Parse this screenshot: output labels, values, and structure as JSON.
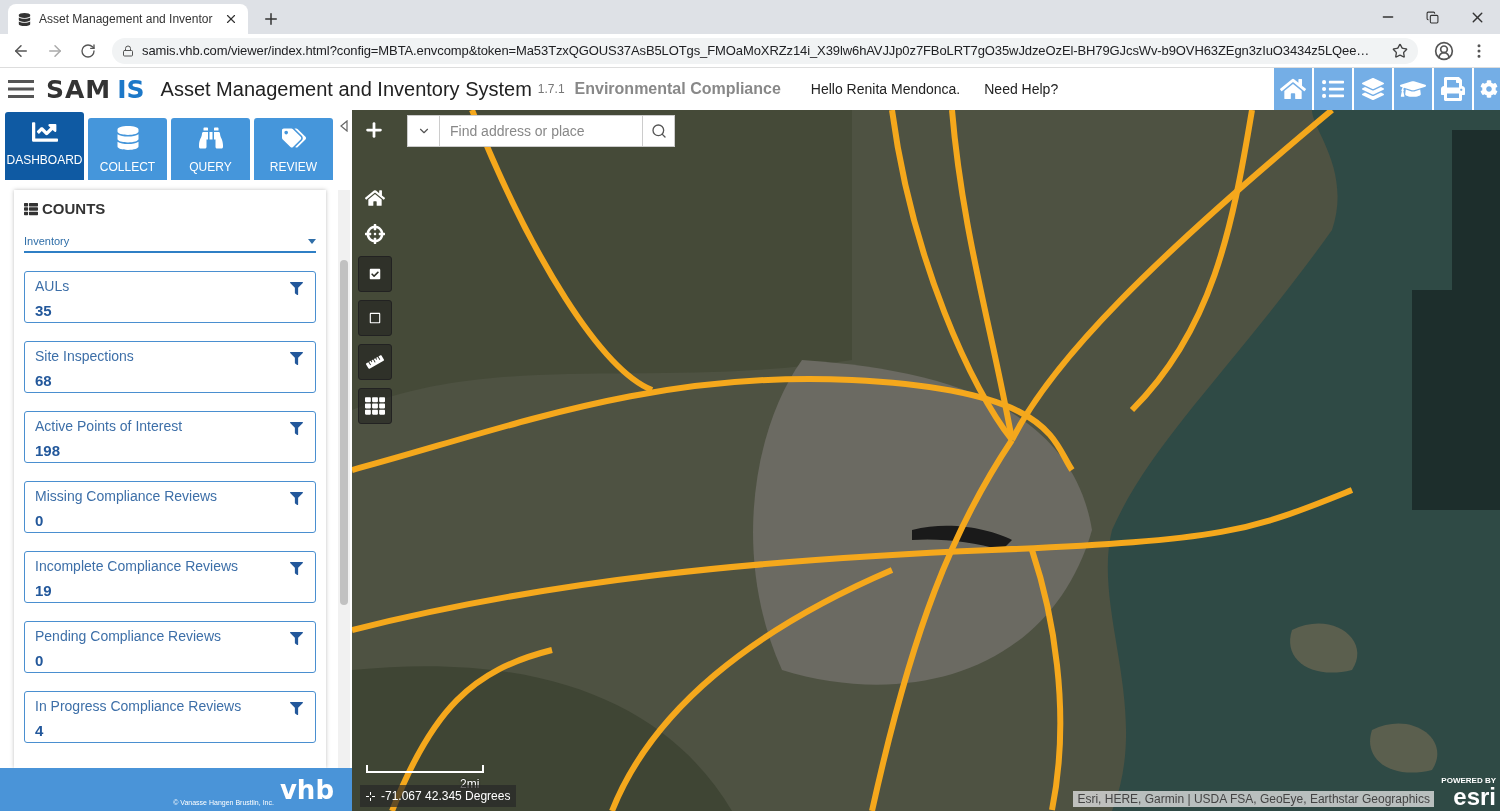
{
  "browser": {
    "tab_title": "Asset Management and Inventor",
    "address": "samis.vhb.com/viewer/index.html?config=MBTA.envcomp&token=Ma53TzxQGOUS37AsB5LOTgs_FMOaMoXRZz14i_X39lw6hAVJJp0z7FBoLRT7gO35wJdzeOzEl-BH79GJcsWv-b9OVH63ZEgn3zIuO3434z5LQee…"
  },
  "header": {
    "logo_left": "SAM",
    "logo_right": "IS",
    "title": "Asset Management and Inventory System",
    "version": "1.7.1",
    "module": "Environmental Compliance",
    "greeting": "Hello Renita Mendonca.",
    "help": "Need Help?"
  },
  "sidebar": {
    "tabs": [
      {
        "label": "DASHBOARD",
        "selected": true
      },
      {
        "label": "COLLECT",
        "selected": false
      },
      {
        "label": "QUERY",
        "selected": false
      },
      {
        "label": "REVIEW",
        "selected": false
      }
    ],
    "counts": {
      "title": "COUNTS",
      "dropdown": "Inventory",
      "cards": [
        {
          "label": "AULs",
          "value": "35"
        },
        {
          "label": "Site Inspections",
          "value": "68"
        },
        {
          "label": "Active Points of Interest",
          "value": "198"
        },
        {
          "label": "Missing Compliance Reviews",
          "value": "0"
        },
        {
          "label": "Incomplete Compliance Reviews",
          "value": "19"
        },
        {
          "label": "Pending Compliance Reviews",
          "value": "0"
        },
        {
          "label": "In Progress Compliance Reviews",
          "value": "4"
        }
      ]
    },
    "footer": {
      "copyright": "© Vanasse Hangen Brustlin, Inc.",
      "logo": "vhb"
    }
  },
  "map": {
    "kind": "picture",
    "search": {
      "placeholder": "Find address or place"
    },
    "scale": "2mi",
    "coordinates": "-71.067 42.345 Degrees",
    "attribution": "Esri, HERE, Garmin | USDA FSA, GeoEye, Earthstar Geographics",
    "powered_by": "POWERED BY",
    "brand": "esri"
  }
}
